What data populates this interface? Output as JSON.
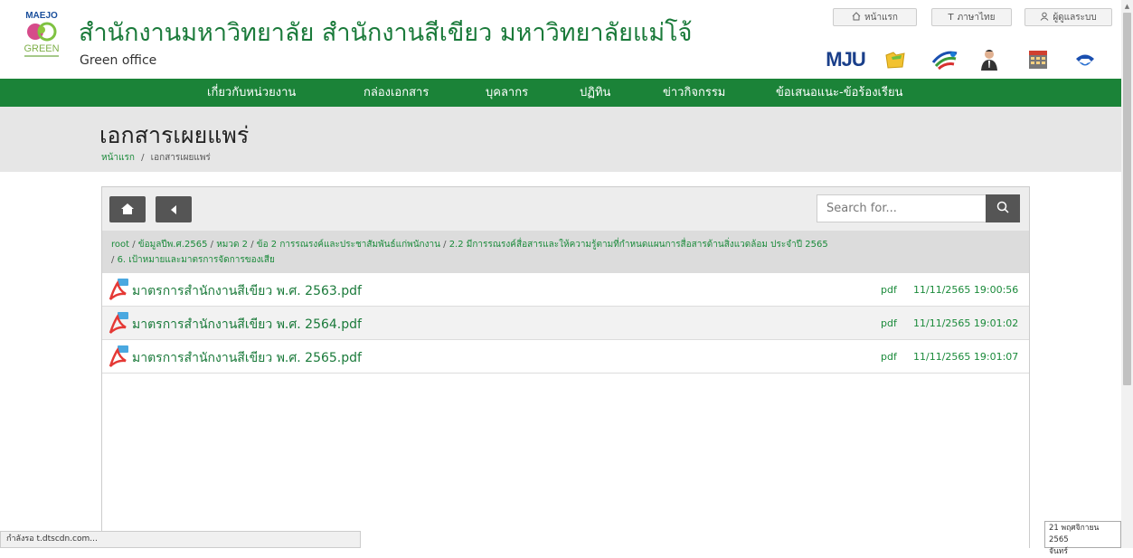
{
  "header": {
    "logo_text": "MAEJO GREEN",
    "title": "สำนักงานมหาวิทยาลัย สำนักงานสีเขียว มหาวิทยาลัยแม่โจ้",
    "subtitle": "Green office",
    "buttons": [
      {
        "label": "หน้าแรก",
        "icon": "home-icon"
      },
      {
        "label": "ภาษาไทย",
        "icon": "text-icon"
      },
      {
        "label": "ผู้ดูแลระบบ",
        "icon": "user-icon"
      }
    ],
    "quick_icons": [
      "mju-logo-icon",
      "folder-icon",
      "network-icon",
      "person-icon",
      "calendar-icon",
      "phone-icon"
    ],
    "mju_text": "MJU"
  },
  "nav": {
    "items": [
      "เกี่ยวกับหน่วยงาน",
      "กล่องเอกสาร",
      "บุคลากร",
      "ปฏิทิน",
      "ข่าวกิจกรรม",
      "ข้อเสนอแนะ-ข้อร้องเรียน"
    ]
  },
  "page": {
    "title": "เอกสารเผยแพร่",
    "breadcrumb_home": "หน้าแรก",
    "breadcrumb_sep": "/",
    "breadcrumb_current": "เอกสารเผยแพร่"
  },
  "browser": {
    "search_placeholder": "Search for...",
    "path": [
      "root",
      "ข้อมูลปีพ.ศ.2565",
      "หมวด 2",
      "ข้อ 2 การรณรงค์และประชาสัมพันธ์แก่พนักงาน",
      "2.2 มีการรณรงค์สื่อสารและให้ความรู้ตามที่กำหนดแผนการสื่อสารด้านสิ่งแวดล้อม ประจำปี 2565",
      "6. เป้าหมายและมาตรการจัดการของเสีย"
    ],
    "files": [
      {
        "name": "มาตรการสำนักงานสีเขียว พ.ศ. 2563.pdf",
        "type": "pdf",
        "date": "11/11/2565 19:00:56"
      },
      {
        "name": "มาตรการสำนักงานสีเขียว พ.ศ. 2564.pdf",
        "type": "pdf",
        "date": "11/11/2565 19:01:02"
      },
      {
        "name": "มาตรการสำนักงานสีเขียว พ.ศ. 2565.pdf",
        "type": "pdf",
        "date": "11/11/2565 19:01:07"
      }
    ]
  },
  "status": {
    "text": "กำลังรอ t.dtscdn.com...",
    "date_tip_line1": "21 พฤศจิกายน 2565",
    "date_tip_line2": "จันทร์"
  },
  "colors": {
    "brand_green": "#1b8338",
    "link_green": "#1a8a3a"
  }
}
